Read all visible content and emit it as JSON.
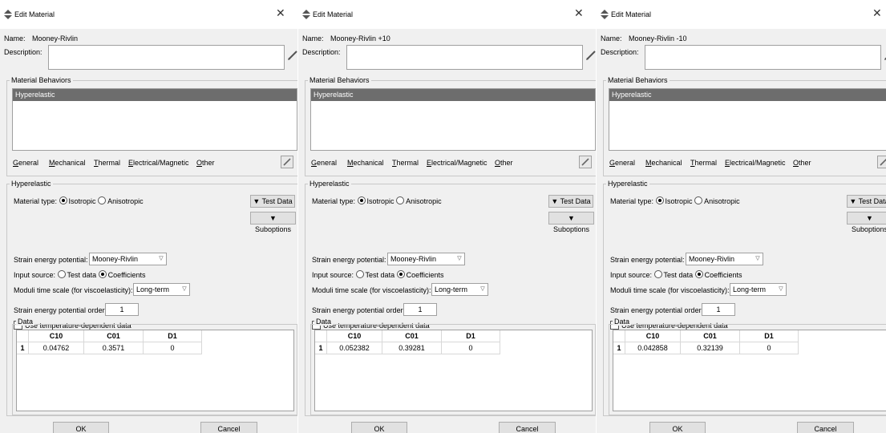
{
  "dialogs": [
    {
      "window_title": "Edit Material",
      "name_label": "Name:",
      "name_value": "Mooney-Rivlin",
      "description_label": "Description:",
      "description_value": "",
      "behaviors_group_title": "Material Behaviors",
      "behaviors": [
        "Hyperelastic"
      ],
      "menu": [
        "General",
        "Mechanical",
        "Thermal",
        "Electrical/Magnetic",
        "Other"
      ],
      "section_title": "Hyperelastic",
      "material_type_label": "Material type:",
      "material_type_options": [
        "Isotropic",
        "Anisotropic"
      ],
      "material_type_selected": "Isotropic",
      "test_data_button": "Test Data",
      "suboptions_button": "Suboptions",
      "strain_energy_potential_label": "Strain energy potential:",
      "strain_energy_potential_value": "Mooney-Rivlin",
      "input_source_label": "Input source:",
      "input_source_options": [
        "Test data",
        "Coefficients"
      ],
      "input_source_selected": "Coefficients",
      "moduli_label": "Moduli time scale (for viscoelasticity):",
      "moduli_value": "Long-term",
      "order_label": "Strain energy potential order:",
      "order_value": "1",
      "temp_checkbox_label": "Use temperature-dependent data",
      "temp_checked": false,
      "data_group_title": "Data",
      "table": {
        "headers": [
          "C10",
          "C01",
          "D1"
        ],
        "rows": [
          {
            "index": "1",
            "cells": [
              "0.04762",
              "0.3571",
              "0"
            ]
          }
        ]
      },
      "ok_button": "OK",
      "cancel_button": "Cancel"
    },
    {
      "window_title": "Edit Material",
      "name_label": "Name:",
      "name_value": "Mooney-Rivlin +10",
      "description_label": "Description:",
      "description_value": "",
      "behaviors_group_title": "Material Behaviors",
      "behaviors": [
        "Hyperelastic"
      ],
      "menu": [
        "General",
        "Mechanical",
        "Thermal",
        "Electrical/Magnetic",
        "Other"
      ],
      "section_title": "Hyperelastic",
      "material_type_label": "Material type:",
      "material_type_options": [
        "Isotropic",
        "Anisotropic"
      ],
      "material_type_selected": "Isotropic",
      "test_data_button": "Test Data",
      "suboptions_button": "Suboptions",
      "strain_energy_potential_label": "Strain energy potential:",
      "strain_energy_potential_value": "Mooney-Rivlin",
      "input_source_label": "Input source:",
      "input_source_options": [
        "Test data",
        "Coefficients"
      ],
      "input_source_selected": "Coefficients",
      "moduli_label": "Moduli time scale (for viscoelasticity):",
      "moduli_value": "Long-term",
      "order_label": "Strain energy potential order:",
      "order_value": "1",
      "temp_checkbox_label": "Use temperature-dependent data",
      "temp_checked": false,
      "data_group_title": "Data",
      "table": {
        "headers": [
          "C10",
          "C01",
          "D1"
        ],
        "rows": [
          {
            "index": "1",
            "cells": [
              "0.052382",
              "0.39281",
              "0"
            ]
          }
        ]
      },
      "ok_button": "OK",
      "cancel_button": "Cancel"
    },
    {
      "window_title": "Edit Material",
      "name_label": "Name:",
      "name_value": "Mooney-Rivlin -10",
      "description_label": "Description:",
      "description_value": "",
      "behaviors_group_title": "Material Behaviors",
      "behaviors": [
        "Hyperelastic"
      ],
      "menu": [
        "General",
        "Mechanical",
        "Thermal",
        "Electrical/Magnetic",
        "Other"
      ],
      "section_title": "Hyperelastic",
      "material_type_label": "Material type:",
      "material_type_options": [
        "Isotropic",
        "Anisotropic"
      ],
      "material_type_selected": "Isotropic",
      "test_data_button": "Test Data",
      "suboptions_button": "Suboptions",
      "strain_energy_potential_label": "Strain energy potential:",
      "strain_energy_potential_value": "Mooney-Rivlin",
      "input_source_label": "Input source:",
      "input_source_options": [
        "Test data",
        "Coefficients"
      ],
      "input_source_selected": "Coefficients",
      "moduli_label": "Moduli time scale (for viscoelasticity):",
      "moduli_value": "Long-term",
      "order_label": "Strain energy potential order:",
      "order_value": "1",
      "temp_checkbox_label": "Use temperature-dependent data",
      "temp_checked": false,
      "data_group_title": "Data",
      "table": {
        "headers": [
          "C10",
          "C01",
          "D1"
        ],
        "rows": [
          {
            "index": "1",
            "cells": [
              "0.042858",
              "0.32139",
              "0"
            ]
          }
        ]
      },
      "ok_button": "OK",
      "cancel_button": "Cancel"
    }
  ]
}
